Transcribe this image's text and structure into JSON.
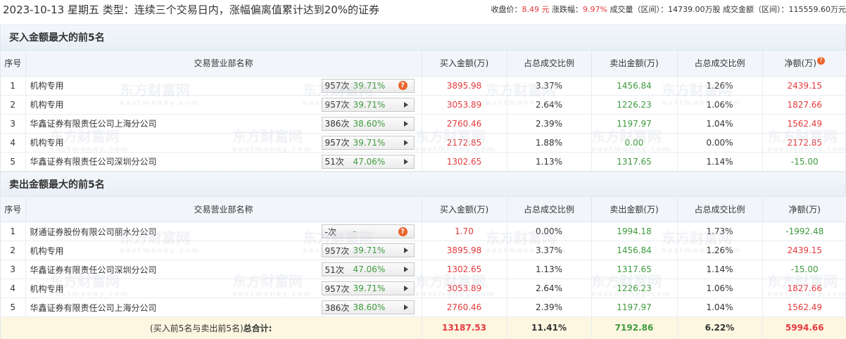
{
  "header": {
    "title": "2023-10-13 星期五 类型：连续三个交易日内，涨幅偏离值累计达到20%的证券",
    "close_label": "收盘价：",
    "close_value": "8.49 元",
    "change_label": "涨跌幅：",
    "change_value": "9.97%",
    "volume_label": "成交量（区间）：",
    "volume_value": "14739.00万股",
    "amount_label": "成交金额（区间）：",
    "amount_value": "115559.60万元"
  },
  "columns": {
    "idx": "序号",
    "name": "交易营业部名称",
    "buy": "买入金额(万)",
    "buy_ratio": "占总成交比例",
    "sell": "卖出金额(万)",
    "sell_ratio": "占总成交比例",
    "net": "净额(万)",
    "net_buy_sec": "净额(万)"
  },
  "buy_section": {
    "title": "买入金额最大的前5名",
    "rows": [
      {
        "idx": "1",
        "name": "机构专用",
        "count": "957次",
        "rate": "39.71%",
        "buy": "3895.98",
        "buy_ratio": "3.37%",
        "sell": "1456.84",
        "sell_ratio": "1.26%",
        "net": "2439.15"
      },
      {
        "idx": "2",
        "name": "机构专用",
        "count": "957次",
        "rate": "39.71%",
        "buy": "3053.89",
        "buy_ratio": "2.64%",
        "sell": "1226.23",
        "sell_ratio": "1.06%",
        "net": "1827.66"
      },
      {
        "idx": "3",
        "name": "华鑫证券有限责任公司上海分公司",
        "count": "386次",
        "rate": "38.60%",
        "buy": "2760.46",
        "buy_ratio": "2.39%",
        "sell": "1197.97",
        "sell_ratio": "1.04%",
        "net": "1562.49"
      },
      {
        "idx": "4",
        "name": "机构专用",
        "count": "957次",
        "rate": "39.71%",
        "buy": "2172.85",
        "buy_ratio": "1.88%",
        "sell": "0.00",
        "sell_ratio": "0.00%",
        "net": "2172.85"
      },
      {
        "idx": "5",
        "name": "华鑫证券有限责任公司深圳分公司",
        "count": "51次",
        "rate": "47.06%",
        "buy": "1302.65",
        "buy_ratio": "1.13%",
        "sell": "1317.65",
        "sell_ratio": "1.14%",
        "net": "-15.00"
      }
    ]
  },
  "sell_section": {
    "title": "卖出金额最大的前5名",
    "rows": [
      {
        "idx": "1",
        "name": "财通证券股份有限公司丽水分公司",
        "count": "-次",
        "rate": "-",
        "buy": "1.70",
        "buy_ratio": "0.00%",
        "sell": "1994.18",
        "sell_ratio": "1.73%",
        "net": "-1992.48"
      },
      {
        "idx": "2",
        "name": "机构专用",
        "count": "957次",
        "rate": "39.71%",
        "buy": "3895.98",
        "buy_ratio": "3.37%",
        "sell": "1456.84",
        "sell_ratio": "1.26%",
        "net": "2439.15"
      },
      {
        "idx": "3",
        "name": "华鑫证券有限责任公司深圳分公司",
        "count": "51次",
        "rate": "47.06%",
        "buy": "1302.65",
        "buy_ratio": "1.13%",
        "sell": "1317.65",
        "sell_ratio": "1.14%",
        "net": "-15.00"
      },
      {
        "idx": "4",
        "name": "机构专用",
        "count": "957次",
        "rate": "39.71%",
        "buy": "3053.89",
        "buy_ratio": "2.64%",
        "sell": "1226.23",
        "sell_ratio": "1.06%",
        "net": "1827.66"
      },
      {
        "idx": "5",
        "name": "华鑫证券有限责任公司上海分公司",
        "count": "386次",
        "rate": "38.60%",
        "buy": "2760.46",
        "buy_ratio": "2.39%",
        "sell": "1197.97",
        "sell_ratio": "1.04%",
        "net": "1562.49"
      }
    ]
  },
  "total": {
    "label_prefix": "(买入前5名与卖出前5名)",
    "label_bold": "总合计:",
    "buy": "13187.53",
    "buy_ratio": "11.41%",
    "sell": "7192.86",
    "sell_ratio": "6.22%",
    "net": "5994.66"
  },
  "watermark": {
    "cn": "东方财富网",
    "en": "eastmoney.com"
  },
  "colors": {
    "up": "#e4393c",
    "down": "#3d9a3d",
    "accent_icon": "#e9652c",
    "total_bg": "#fdf6e1",
    "header_bg": "#f2f6fa"
  },
  "icons": {
    "row1": "question-icon",
    "rows": "play-arrow-icon",
    "net_header": "question-icon"
  }
}
